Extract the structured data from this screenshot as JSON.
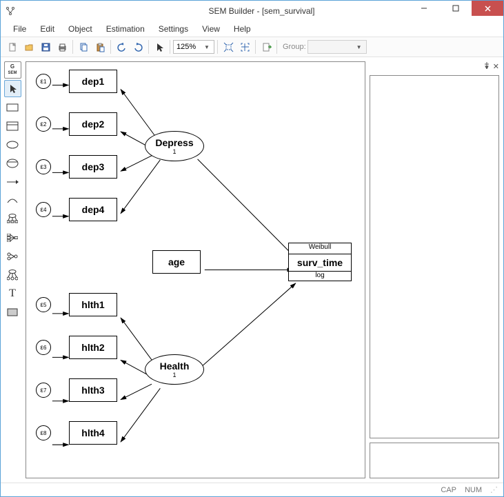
{
  "title": "SEM Builder - [sem_survival]",
  "menu": {
    "file": "File",
    "edit": "Edit",
    "object": "Object",
    "estimation": "Estimation",
    "settings": "Settings",
    "view": "View",
    "help": "Help"
  },
  "toolbar": {
    "zoom": "125%",
    "group_label": "Group:",
    "group_value": ""
  },
  "statusbar": {
    "cap": "CAP",
    "num": "NUM"
  },
  "tools": {
    "gsem": "G SEM"
  },
  "diagram": {
    "latent": {
      "depress": "Depress",
      "depress_sub": "1",
      "health": "Health",
      "health_sub": "1"
    },
    "observed": {
      "dep1": "dep1",
      "dep2": "dep2",
      "dep3": "dep3",
      "dep4": "dep4",
      "age": "age",
      "hlth1": "hlth1",
      "hlth2": "hlth2",
      "hlth3": "hlth3",
      "hlth4": "hlth4"
    },
    "outcome": {
      "family": "Weibull",
      "name": "surv_time",
      "link": "log"
    },
    "errors": {
      "e1": "1",
      "e2": "2",
      "e3": "3",
      "e4": "4",
      "e5": "5",
      "e6": "6",
      "e7": "7",
      "e8": "8"
    }
  }
}
